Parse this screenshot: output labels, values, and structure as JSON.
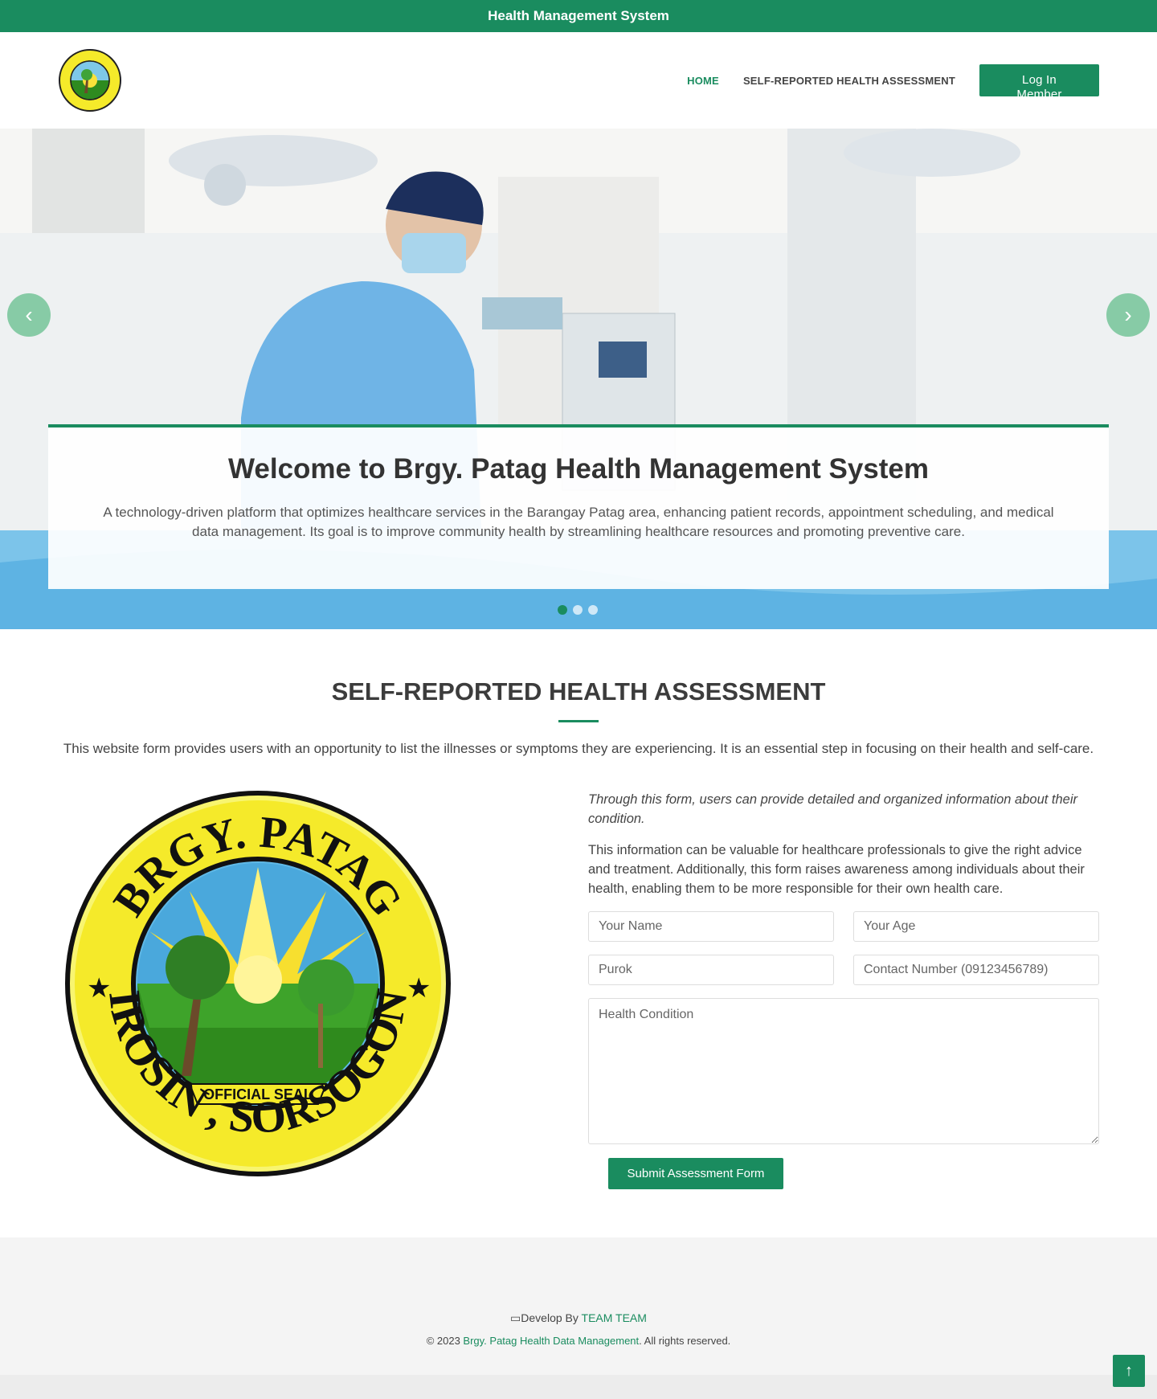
{
  "topbar": {
    "title": "Health Management System"
  },
  "nav": {
    "home": "HOME",
    "assessment": "SELF-REPORTED HEALTH ASSESSMENT",
    "login": "Log In Member"
  },
  "logo": {
    "top_text": "BRGY. PATAG",
    "bottom_text": "IROSIN , SORSOGON"
  },
  "hero": {
    "title": "Welcome to Brgy. Patag Health Management System",
    "description": "A technology-driven platform that optimizes healthcare services in the Barangay Patag area, enhancing patient records, appointment scheduling, and medical data management. Its goal is to improve community health by streamlining healthcare resources and promoting preventive care.",
    "prev_icon": "chevron-left-icon",
    "next_icon": "chevron-right-icon",
    "slides": 3,
    "active_slide": 1
  },
  "assessment": {
    "title": "SELF-REPORTED HEALTH ASSESSMENT",
    "description": "This website form provides users with an opportunity to list the illnesses or symptoms they are experiencing. It is an essential step in focusing on their health and self-care.",
    "intro_italic": "Through this form, users can provide detailed and organized information about their condition.",
    "intro_text": "This information can be valuable for healthcare professionals to give the right advice and treatment. Additionally, this form raises awareness among individuals about their health, enabling them to be more responsible for their own health care.",
    "fields": {
      "name": "Your Name",
      "age": "Your Age",
      "purok": "Purok",
      "contact": "Contact Number (09123456789)",
      "condition": "Health Condition"
    },
    "submit": "Submit Assessment Form"
  },
  "seal": {
    "top_text": "BRGY. PATAG",
    "bottom_text": "IROSIN , SORSOGON",
    "ribbon": "OFFICIAL SEAL"
  },
  "footer": {
    "develop_prefix": "Develop By ",
    "team": "TEAM TEAM",
    "copyright_prefix": "© 2023 ",
    "org": "Brgy. Patag Health Data Management",
    "rights": ". All rights reserved.",
    "laptop_icon": "laptop-icon"
  },
  "colors": {
    "brand": "#1a8c5f",
    "seal_yellow": "#f5ea2a",
    "seal_green": "#2e8b1f"
  }
}
